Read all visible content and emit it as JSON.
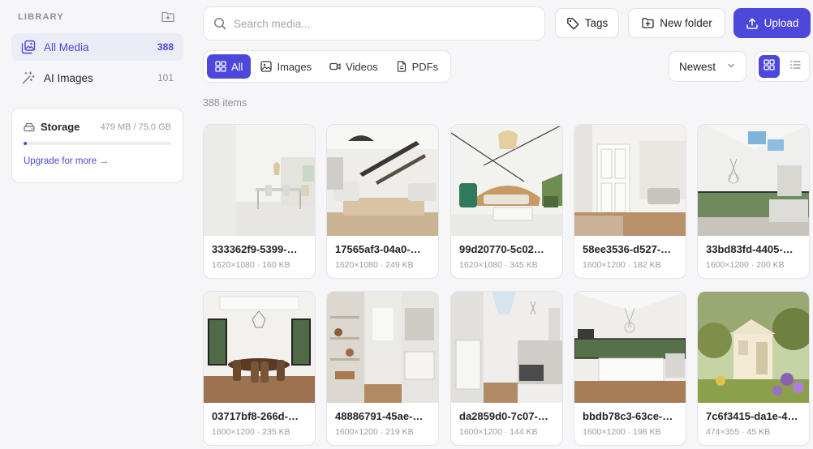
{
  "sidebar": {
    "section_title": "LIBRARY",
    "items": [
      {
        "label": "All Media",
        "count": "388"
      },
      {
        "label": "AI Images",
        "count": "101"
      }
    ],
    "storage": {
      "title": "Storage",
      "usage": "479 MB / 75.0 GB",
      "used_fraction": 0.0064,
      "upgrade_label": "Upgrade for more →"
    }
  },
  "toolbar": {
    "search_placeholder": "Search media...",
    "search_value": "",
    "tags_label": "Tags",
    "new_folder_label": "New folder",
    "upload_label": "Upload"
  },
  "filters": {
    "tabs": [
      "All",
      "Images",
      "Videos",
      "PDFs"
    ],
    "active": "All",
    "sort_label": "Newest",
    "view": "grid"
  },
  "items_count": "388 items",
  "media": [
    {
      "name": "333362f9-5399-…",
      "meta": "1620×1080 · 160 KB"
    },
    {
      "name": "17565af3-04a0-…",
      "meta": "1620×1080 · 249 KB"
    },
    {
      "name": "99d20770-5c02…",
      "meta": "1620×1080 · 345 KB"
    },
    {
      "name": "58ee3536-d527-…",
      "meta": "1600×1200 · 182 KB"
    },
    {
      "name": "33bd83fd-4405-…",
      "meta": "1600×1200 · 200 KB"
    },
    {
      "name": "03717bf8-266d-…",
      "meta": "1600×1200 · 235 KB"
    },
    {
      "name": "48886791-45ae-…",
      "meta": "1600×1200 · 219 KB"
    },
    {
      "name": "da2859d0-7c07-…",
      "meta": "1600×1200 · 144 KB"
    },
    {
      "name": "bbdb78c3-63ce-…",
      "meta": "1600×1200 · 198 KB"
    },
    {
      "name": "7c6f3415-da1e-4…",
      "meta": "474×355 · 45 KB"
    }
  ],
  "colors": {
    "accent": "#4c48dc",
    "active_nav_bg": "#ececf7",
    "background": "#f6f6f8"
  }
}
